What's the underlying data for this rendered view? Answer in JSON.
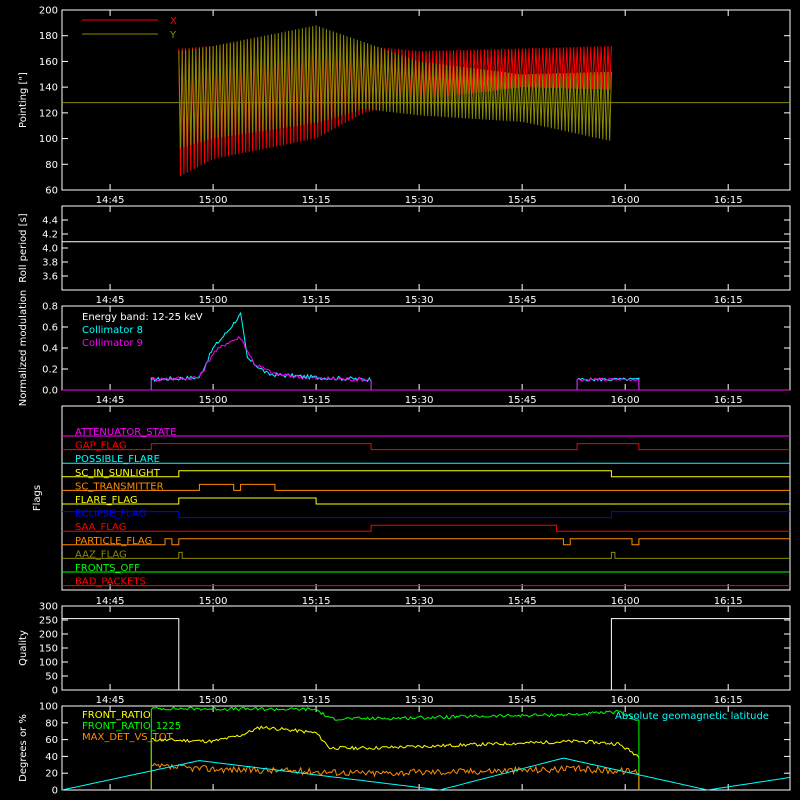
{
  "time_ticks": [
    "14:45",
    "15:00",
    "15:15",
    "15:30",
    "15:45",
    "16:00",
    "16:15"
  ],
  "colors": {
    "background": "#000000",
    "axes": "#ffffff",
    "red": "#ff0000",
    "olive": "#8a8a00",
    "white": "#ffffff",
    "cyan": "#00ffff",
    "magenta": "#ff00ff",
    "yellow": "#ffff00",
    "orange": "#ff8c00",
    "green": "#00ff00",
    "blue": "#0000ff"
  },
  "chart_data": [
    {
      "type": "line",
      "id": "pointing",
      "ylabel": "Pointing [\"]",
      "ylim": [
        60,
        200
      ],
      "yticks": [
        "60",
        "80",
        "100",
        "120",
        "140",
        "160",
        "180",
        "200"
      ],
      "xlim": [
        "14:38",
        "16:24"
      ],
      "legend": [
        {
          "name": "X",
          "color": "#ff0000"
        },
        {
          "name": "Y",
          "color": "#8a8a00"
        }
      ],
      "reference_level": 128,
      "series": [
        {
          "name": "X",
          "color": "#ff0000",
          "envelope_x": [
            "14:55",
            "15:00",
            "15:15",
            "15:22",
            "15:30",
            "15:45",
            "15:58"
          ],
          "upper": [
            170,
            172,
            180,
            172,
            168,
            170,
            172
          ],
          "lower": [
            70,
            84,
            100,
            120,
            130,
            140,
            138
          ]
        },
        {
          "name": "Y",
          "color": "#8a8a00",
          "envelope_x": [
            "14:55",
            "15:00",
            "15:15",
            "15:22",
            "15:30",
            "15:45",
            "15:58"
          ],
          "upper": [
            168,
            172,
            188,
            175,
            160,
            150,
            152
          ],
          "lower": [
            92,
            100,
            112,
            123,
            118,
            113,
            98
          ]
        }
      ]
    },
    {
      "type": "line",
      "id": "roll_period",
      "ylabel": "Roll period [s]",
      "ylim": [
        3.4,
        4.6
      ],
      "yticks": [
        "3.6",
        "3.8",
        "4.0",
        "4.2",
        "4.4"
      ],
      "series": [
        {
          "name": "roll",
          "color": "#ffffff",
          "x": [
            "14:38",
            "16:24"
          ],
          "y": [
            4.09,
            4.09
          ]
        }
      ]
    },
    {
      "type": "line",
      "id": "modulation",
      "ylabel": "Normalized modulation",
      "ylim": [
        0.0,
        0.8
      ],
      "yticks": [
        "0.0",
        "0.2",
        "0.4",
        "0.6",
        "0.8"
      ],
      "annotation": "Energy band: 12-25 keV",
      "legend": [
        {
          "name": "Collimator 8",
          "color": "#00ffff"
        },
        {
          "name": "Collimator 9",
          "color": "#ff00ff"
        }
      ],
      "series": [
        {
          "name": "Collimator 8",
          "color": "#00ffff",
          "x": [
            "14:51",
            "14:58",
            "15:00",
            "15:02",
            "15:04",
            "15:05",
            "15:08",
            "15:15",
            "15:23"
          ],
          "y": [
            0.1,
            0.12,
            0.4,
            0.55,
            0.72,
            0.3,
            0.15,
            0.12,
            0.1
          ]
        },
        {
          "name": "Collimator 9",
          "color": "#ff00ff",
          "x": [
            "14:51",
            "14:58",
            "15:00",
            "15:02",
            "15:04",
            "15:06",
            "15:09",
            "15:15",
            "15:23"
          ],
          "y": [
            0.1,
            0.12,
            0.35,
            0.45,
            0.5,
            0.25,
            0.15,
            0.11,
            0.1
          ]
        }
      ]
    },
    {
      "type": "line",
      "id": "flags",
      "ylabel": "Flags",
      "flags": [
        {
          "name": "ATTENUATOR_STATE",
          "color": "#ff00ff"
        },
        {
          "name": "GAP_FLAG",
          "color": "#ff0000"
        },
        {
          "name": "POSSIBLE_FLARE",
          "color": "#00ffff"
        },
        {
          "name": "SC_IN_SUNLIGHT",
          "color": "#ffff00"
        },
        {
          "name": "SC_TRANSMITTER",
          "color": "#ff8c00"
        },
        {
          "name": "FLARE_FLAG",
          "color": "#ffff00"
        },
        {
          "name": "ECLIPSE_FLAG",
          "color": "#0000ff"
        },
        {
          "name": "SAA_FLAG",
          "color": "#ff0000"
        },
        {
          "name": "PARTICLE_FLAG",
          "color": "#ff8c00"
        },
        {
          "name": "AAZ_FLAG",
          "color": "#8a8a00"
        },
        {
          "name": "FRONTS_OFF",
          "color": "#00ff00"
        },
        {
          "name": "BAD_PACKETS",
          "color": "#ff0000"
        }
      ]
    },
    {
      "type": "line",
      "id": "quality",
      "ylabel": "Quality",
      "ylim": [
        0,
        300
      ],
      "yticks": [
        "0",
        "50",
        "100",
        "150",
        "200",
        "250",
        "300"
      ],
      "series": [
        {
          "name": "quality",
          "color": "#ffffff",
          "x": [
            "14:38",
            "14:55",
            "14:55",
            "15:58",
            "15:58",
            "16:24"
          ],
          "y": [
            255,
            255,
            0,
            0,
            255,
            255
          ]
        }
      ]
    },
    {
      "type": "line",
      "id": "ratios",
      "ylabel": "Degrees or %",
      "ylim": [
        0,
        100
      ],
      "yticks": [
        "0",
        "20",
        "40",
        "60",
        "80",
        "100"
      ],
      "legend": [
        {
          "name": "FRONT_RATIO",
          "color": "#ffff00"
        },
        {
          "name": "FRONT_RATIO_1225",
          "color": "#00ff00"
        },
        {
          "name": "MAX_DET_VS_TOT",
          "color": "#ff8c00"
        }
      ],
      "right_label": {
        "text": "Absolute geomagnetic latitude",
        "color": "#00ffff"
      },
      "series": [
        {
          "name": "FRONT_RATIO",
          "color": "#ffff00",
          "x": [
            "14:51",
            "15:00",
            "15:04",
            "15:07",
            "15:15",
            "15:17",
            "15:23",
            "15:53",
            "15:59",
            "16:02"
          ],
          "y": [
            60,
            58,
            65,
            75,
            68,
            50,
            50,
            58,
            55,
            40
          ]
        },
        {
          "name": "FRONT_RATIO_1225",
          "color": "#00ff00",
          "x": [
            "14:51",
            "15:15",
            "15:17",
            "15:23",
            "15:53",
            "15:59",
            "16:02"
          ],
          "y": [
            97,
            96,
            85,
            85,
            90,
            93,
            83
          ]
        },
        {
          "name": "MAX_DET_VS_TOT",
          "color": "#ff8c00",
          "x": [
            "14:51",
            "15:00",
            "15:15",
            "15:23",
            "15:53",
            "16:02"
          ],
          "y": [
            28,
            25,
            22,
            20,
            25,
            22
          ]
        },
        {
          "name": "Absolute geomagnetic latitude",
          "color": "#00ffff",
          "x": [
            "14:38",
            "14:58",
            "15:33",
            "15:51",
            "16:12",
            "16:24"
          ],
          "y": [
            0,
            35,
            0,
            38,
            0,
            15
          ]
        }
      ]
    }
  ]
}
